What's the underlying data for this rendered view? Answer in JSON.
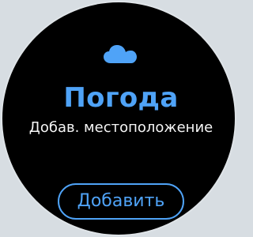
{
  "screen": {
    "icon": "cloud-icon",
    "title": "Погода",
    "subtitle": "Добав. местоположение",
    "add_button_label": "Добавить"
  },
  "colors": {
    "accent": "#4fa3f7",
    "background": "#000000",
    "text": "#f5f5f5"
  }
}
